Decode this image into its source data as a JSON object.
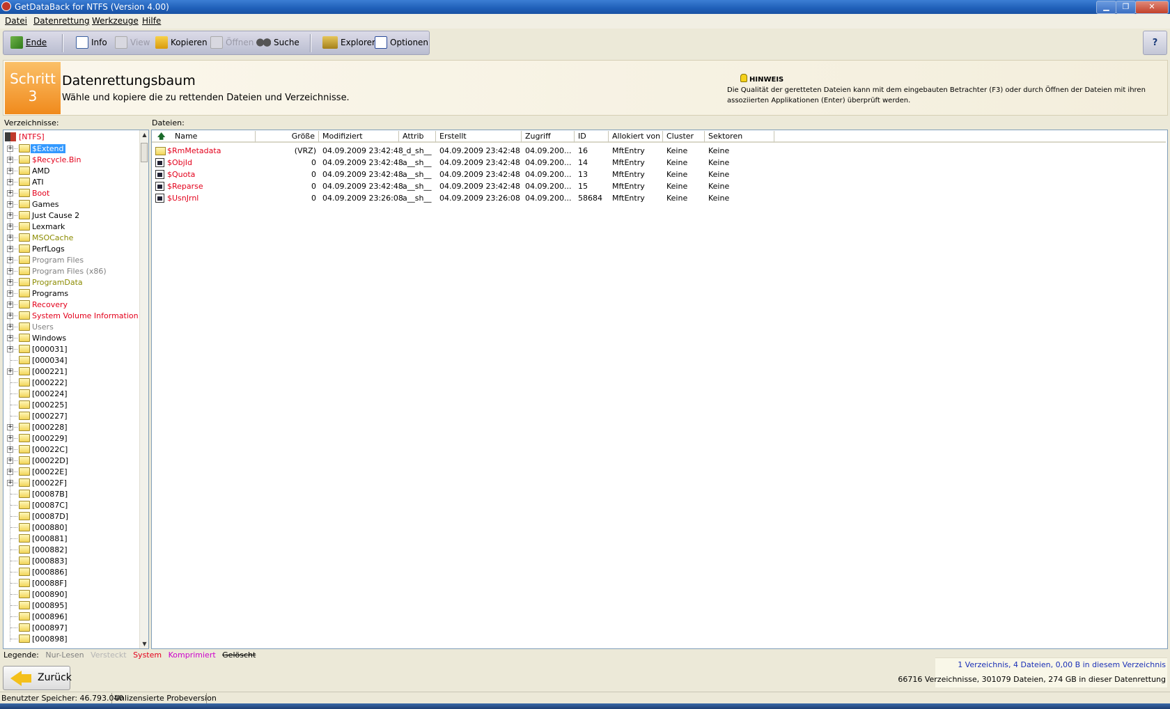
{
  "window": {
    "title": "GetDataBack for NTFS (Version 4.00)",
    "buttons": {
      "minimize": "▁",
      "restore": "❐",
      "close": "✕"
    }
  },
  "menu": [
    "Datei",
    "Datenrettung",
    "Werkzeuge",
    "Hilfe"
  ],
  "toolbar": {
    "ende": "Ende",
    "info": "Info",
    "view": "View",
    "kopieren": "Kopieren",
    "oeffnen": "Öffnen",
    "suche": "Suche",
    "explorer": "Explorer",
    "optionen": "Optionen",
    "help": "?"
  },
  "header": {
    "step_word": "Schritt",
    "step_num": "3",
    "title": "Datenrettungsbaum",
    "subtitle": "Wähle und kopiere die zu rettenden Dateien und Verzeichnisse.",
    "hint_label": "HINWEIS",
    "hint_text": "Die Qualität der geretteten Dateien kann mit dem eingebauten Betrachter (F3) oder durch Öffnen der Dateien mit ihren assoziierten Applikationen (Enter) überprüft werden."
  },
  "panes": {
    "dirs_label": "Verzeichnisse:",
    "files_label": "Dateien:"
  },
  "colors": {
    "system": "#e3001b",
    "readonly": "#808080",
    "hidden": "#b5b5b5",
    "compressed": "#cc00cc",
    "special": "#8b8b00",
    "normal": "#000000",
    "selection": "#3399ff"
  },
  "tree": {
    "root": "[NTFS]",
    "items": [
      {
        "label": "$Extend",
        "color": "#ffffff",
        "expander": "+",
        "selected": true
      },
      {
        "label": "$Recycle.Bin",
        "color": "#e3001b",
        "expander": "+"
      },
      {
        "label": "AMD",
        "color": "#000000",
        "expander": "+"
      },
      {
        "label": "ATI",
        "color": "#000000",
        "expander": "+"
      },
      {
        "label": "Boot",
        "color": "#e3001b",
        "expander": "+"
      },
      {
        "label": "Games",
        "color": "#000000",
        "expander": "+"
      },
      {
        "label": "Just Cause 2",
        "color": "#000000",
        "expander": "+"
      },
      {
        "label": "Lexmark",
        "color": "#000000",
        "expander": "+"
      },
      {
        "label": "MSOCache",
        "color": "#8b8b00",
        "expander": "+"
      },
      {
        "label": "PerfLogs",
        "color": "#000000",
        "expander": "+"
      },
      {
        "label": "Program Files",
        "color": "#808080",
        "expander": "+"
      },
      {
        "label": "Program Files (x86)",
        "color": "#808080",
        "expander": "+"
      },
      {
        "label": "ProgramData",
        "color": "#8b8b00",
        "expander": "+"
      },
      {
        "label": "Programs",
        "color": "#000000",
        "expander": "+"
      },
      {
        "label": "Recovery",
        "color": "#e3001b",
        "expander": "+"
      },
      {
        "label": "System Volume Information",
        "color": "#e3001b",
        "expander": "+"
      },
      {
        "label": "Users",
        "color": "#808080",
        "expander": "+"
      },
      {
        "label": "Windows",
        "color": "#000000",
        "expander": "+"
      },
      {
        "label": "[000031]",
        "color": "#000000",
        "expander": "+"
      },
      {
        "label": "[000034]",
        "color": "#000000",
        "expander": ""
      },
      {
        "label": "[000221]",
        "color": "#000000",
        "expander": "+"
      },
      {
        "label": "[000222]",
        "color": "#000000",
        "expander": ""
      },
      {
        "label": "[000224]",
        "color": "#000000",
        "expander": ""
      },
      {
        "label": "[000225]",
        "color": "#000000",
        "expander": ""
      },
      {
        "label": "[000227]",
        "color": "#000000",
        "expander": ""
      },
      {
        "label": "[000228]",
        "color": "#000000",
        "expander": "+"
      },
      {
        "label": "[000229]",
        "color": "#000000",
        "expander": "+"
      },
      {
        "label": "[00022C]",
        "color": "#000000",
        "expander": "+"
      },
      {
        "label": "[00022D]",
        "color": "#000000",
        "expander": "+"
      },
      {
        "label": "[00022E]",
        "color": "#000000",
        "expander": "+"
      },
      {
        "label": "[00022F]",
        "color": "#000000",
        "expander": "+"
      },
      {
        "label": "[00087B]",
        "color": "#000000",
        "expander": ""
      },
      {
        "label": "[00087C]",
        "color": "#000000",
        "expander": ""
      },
      {
        "label": "[00087D]",
        "color": "#000000",
        "expander": ""
      },
      {
        "label": "[000880]",
        "color": "#000000",
        "expander": ""
      },
      {
        "label": "[000881]",
        "color": "#000000",
        "expander": ""
      },
      {
        "label": "[000882]",
        "color": "#000000",
        "expander": ""
      },
      {
        "label": "[000883]",
        "color": "#000000",
        "expander": ""
      },
      {
        "label": "[000886]",
        "color": "#000000",
        "expander": ""
      },
      {
        "label": "[00088F]",
        "color": "#000000",
        "expander": ""
      },
      {
        "label": "[000890]",
        "color": "#000000",
        "expander": ""
      },
      {
        "label": "[000895]",
        "color": "#000000",
        "expander": ""
      },
      {
        "label": "[000896]",
        "color": "#000000",
        "expander": ""
      },
      {
        "label": "[000897]",
        "color": "#000000",
        "expander": ""
      },
      {
        "label": "[000898]",
        "color": "#000000",
        "expander": ""
      }
    ]
  },
  "files": {
    "columns": [
      "Name",
      "Größe",
      "Modifiziert",
      "Attrib",
      "Erstellt",
      "Zugriff",
      "ID",
      "Allokiert von",
      "Cluster",
      "Sektoren"
    ],
    "rows": [
      {
        "icon": "folder-icon",
        "name": "$RmMetadata",
        "size": "(VRZ)",
        "modified": "04.09.2009 23:42:48",
        "attrib": "_d_sh__",
        "created": "04.09.2009 23:42:48",
        "access": "04.09.200...",
        "id": "16",
        "alloc": "MftEntry",
        "cluster": "Keine",
        "sectors": "Keine"
      },
      {
        "icon": "file-icon",
        "name": "$ObjId",
        "size": "0",
        "modified": "04.09.2009 23:42:48",
        "attrib": "a__sh__",
        "created": "04.09.2009 23:42:48",
        "access": "04.09.200...",
        "id": "14",
        "alloc": "MftEntry",
        "cluster": "Keine",
        "sectors": "Keine"
      },
      {
        "icon": "file-icon",
        "name": "$Quota",
        "size": "0",
        "modified": "04.09.2009 23:42:48",
        "attrib": "a__sh__",
        "created": "04.09.2009 23:42:48",
        "access": "04.09.200...",
        "id": "13",
        "alloc": "MftEntry",
        "cluster": "Keine",
        "sectors": "Keine"
      },
      {
        "icon": "file-icon",
        "name": "$Reparse",
        "size": "0",
        "modified": "04.09.2009 23:42:48",
        "attrib": "a__sh__",
        "created": "04.09.2009 23:42:48",
        "access": "04.09.200...",
        "id": "15",
        "alloc": "MftEntry",
        "cluster": "Keine",
        "sectors": "Keine"
      },
      {
        "icon": "file-icon",
        "name": "$UsnJrnl",
        "size": "0",
        "modified": "04.09.2009 23:26:08",
        "attrib": "a__sh__",
        "created": "04.09.2009 23:26:08",
        "access": "04.09.200...",
        "id": "58684",
        "alloc": "MftEntry",
        "cluster": "Keine",
        "sectors": "Keine"
      }
    ]
  },
  "legend": {
    "label": "Legende:",
    "readonly": "Nur-Lesen",
    "hidden": "Versteckt",
    "system": "System",
    "compressed": "Komprimiert",
    "deleted": "Gelöscht"
  },
  "back_button": "Zurück",
  "stats": {
    "selection": "1 Verzeichnis, 4 Dateien, 0,00 B in diesem Verzeichnis",
    "total": "66716 Verzeichnisse, 301079 Dateien, 274 GB in dieser Datenrettung"
  },
  "status": {
    "memory": "Benutzter Speicher: 46.793.040",
    "license": "Unlizensierte Probeversion"
  }
}
